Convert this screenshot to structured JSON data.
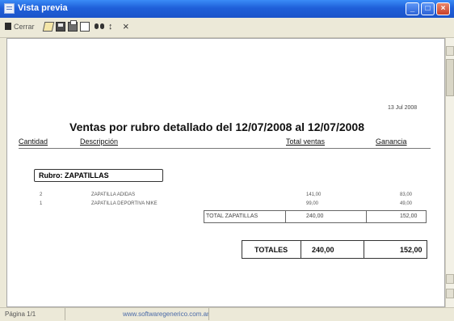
{
  "window": {
    "title": "Vista previa",
    "buttons": {
      "minimize": "_",
      "maximize": "□",
      "close": "×"
    }
  },
  "toolbar": {
    "close_label": "Cerrar",
    "icons": [
      "page-setup-icon",
      "save-icon",
      "print-icon",
      "single-page-icon",
      "find-icon",
      "navigate-icon",
      "close-icon"
    ],
    "nav_glyph": "↕",
    "close_glyph": "×"
  },
  "report": {
    "date": "13 Jul 2008",
    "title": "Ventas por rubro detallado del 12/07/2008 al 12/07/2008",
    "columns": {
      "cantidad": "Cantidad",
      "descripcion": "Descripción",
      "total": "Total ventas",
      "ganancia": "Ganancia"
    },
    "rubro": "Rubro: ZAPATILLAS",
    "items": [
      {
        "cantidad": "2",
        "descripcion": "ZAPATILLA ADIDAS",
        "total": "141,00",
        "ganancia": "83,00"
      },
      {
        "cantidad": "1",
        "descripcion": "ZAPATILLA DEPORTIVA NIKE",
        "total": "99,00",
        "ganancia": "49,00"
      }
    ],
    "subtotal": {
      "label": "TOTAL ZAPATILLAS",
      "total": "240,00",
      "ganancia": "152,00"
    },
    "totals": {
      "label": "TOTALES",
      "total": "240,00",
      "ganancia": "152,00"
    }
  },
  "statusbar": {
    "page": "Página 1/1",
    "link": "www.softwaregenerico.com.ar"
  },
  "colors": {
    "titlebar": "#1f5fd9",
    "chrome": "#ece9d8",
    "paper": "#ffffff"
  }
}
